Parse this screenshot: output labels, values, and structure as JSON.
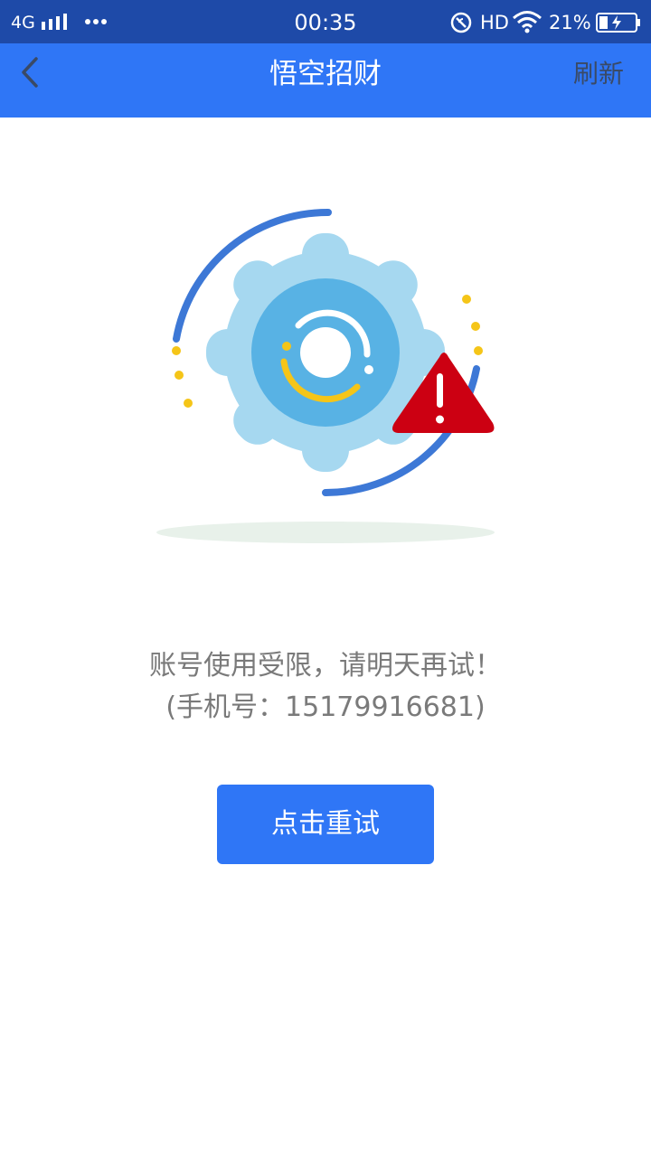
{
  "status_bar": {
    "network": "4G",
    "time": "00:35",
    "hd": "HD",
    "battery_percent": "21%",
    "icons": [
      "signal-icon",
      "more-dots-icon",
      "nfc-icon",
      "wifi-icon",
      "battery-icon"
    ]
  },
  "nav": {
    "title": "悟空招财",
    "refresh_label": "刷新",
    "back_icon": "chevron-left-icon"
  },
  "message": {
    "line1": "账号使用受限，请明天再试！",
    "line2": "(手机号：15179916681)"
  },
  "retry_button": {
    "label": "点击重试"
  },
  "colors": {
    "status_bar": "#1e4aa8",
    "nav_bar": "#2f76f6",
    "button": "#2f76f6",
    "message_text": "#7a7a7a",
    "gear_light": "#a6d8f0",
    "gear_inner": "#58b2e4",
    "warning_red": "#cc0012",
    "accent_yellow": "#f5c518",
    "arc_blue": "#3d78d6"
  }
}
